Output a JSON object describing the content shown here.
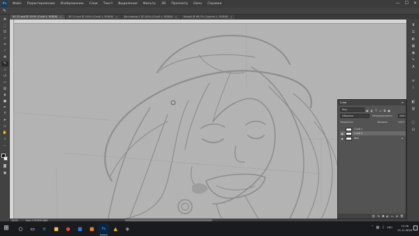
{
  "menubar": {
    "logo": "Ps",
    "items": [
      "Файл",
      "Редактирование",
      "Изображение",
      "Слои",
      "Текст",
      "Выделение",
      "Фильтр",
      "3D",
      "Просмотр",
      "Окно",
      "Справка"
    ]
  },
  "window_controls": {
    "minimize": "—",
    "maximize": "☐",
    "close": "✕"
  },
  "tabs": [
    {
      "label": "45-12.psd @ 100% (Слой 4, RGB/8)",
      "active": true
    },
    {
      "label": "45-12.psd @ 100% (Слой 1, RGB/8)",
      "active": false
    },
    {
      "label": "Без имени-1 @ 100% (Слой 1, RGB/8)",
      "active": false
    },
    {
      "label": "Новый @ 66,7% (Группа 1, RGB/8)",
      "active": false
    }
  ],
  "statusbar": {
    "zoom": "100%",
    "doc": "Док: 2,87М/5,56М"
  },
  "layers_panel": {
    "title": "Слои",
    "menu": "≡",
    "filter": "Вид",
    "blend_mode": "Обычные",
    "opacity_label": "Непрозрачность:",
    "opacity_value": "100%",
    "lock_label": "Закрепить:",
    "fill_label": "Заливка:",
    "fill_value": "100%",
    "layers": [
      {
        "name": "Слой 1",
        "visible": false,
        "selected": false,
        "locked": false
      },
      {
        "name": "Слой 2",
        "visible": true,
        "selected": true,
        "locked": false
      },
      {
        "name": "Фон",
        "visible": true,
        "selected": false,
        "locked": true
      }
    ]
  },
  "taskbar": {
    "start_icon": "windows-logo-icon",
    "apps": [
      {
        "name": "search",
        "glyph": "○",
        "color": "#ffffff",
        "bg": "transparent"
      },
      {
        "name": "task-view",
        "glyph": "▭",
        "color": "#ffffff",
        "bg": "transparent"
      },
      {
        "name": "edge",
        "glyph": "e",
        "color": "#3b9cf5",
        "bg": "transparent"
      },
      {
        "name": "explorer",
        "glyph": "■",
        "color": "#f3c445",
        "bg": "transparent"
      },
      {
        "name": "chrome",
        "glyph": "●",
        "color": "#e8453c",
        "bg": "transparent"
      },
      {
        "name": "app-blue",
        "glyph": "■",
        "color": "#2e7bd6",
        "bg": "transparent"
      },
      {
        "name": "app-orange",
        "glyph": "■",
        "color": "#e8822a",
        "bg": "transparent"
      },
      {
        "name": "photoshop",
        "glyph": "Ps",
        "color": "#31a8ff",
        "bg": "#0b2541"
      },
      {
        "name": "app-gold",
        "glyph": "▲",
        "color": "#f0b13a",
        "bg": "transparent"
      },
      {
        "name": "app-dark",
        "glyph": "◆",
        "color": "#8e8e8e",
        "bg": "transparent"
      }
    ],
    "tray_lang": "ENG",
    "time": "11:18",
    "date": "21.11.2016"
  },
  "colors": {
    "canvas": "#b3b3b3",
    "sketch": "#8d8d8d",
    "ui_dark": "#424242",
    "accent": "#31a8ff"
  }
}
